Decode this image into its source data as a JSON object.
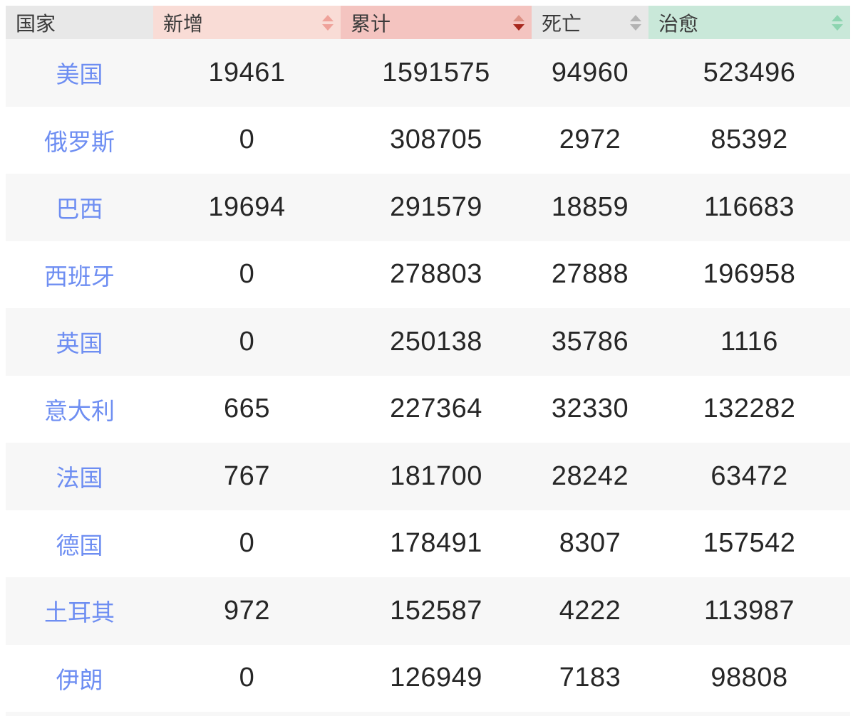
{
  "table": {
    "columns": [
      {
        "key": "country",
        "label": "国家",
        "sortable": false,
        "bg": "#e8e8e8"
      },
      {
        "key": "new",
        "label": "新增",
        "sortable": true,
        "bg": "#f9dcd6",
        "sort": "none",
        "caret_up_color": "#efa29a",
        "caret_down_color": "#efa29a"
      },
      {
        "key": "total",
        "label": "累计",
        "sortable": true,
        "bg": "#f4c4c0",
        "sort": "desc",
        "caret_up_color": "#dd9185",
        "caret_down_color": "#a7281e"
      },
      {
        "key": "deaths",
        "label": "死亡",
        "sortable": true,
        "bg": "#e8e8e8",
        "sort": "none",
        "caret_up_color": "#b3b3b3",
        "caret_down_color": "#b3b3b3"
      },
      {
        "key": "recovered",
        "label": "治愈",
        "sortable": true,
        "bg": "#c9e8d9",
        "sort": "none",
        "caret_up_color": "#8dd4b0",
        "caret_down_color": "#8dd4b0"
      }
    ],
    "rows": [
      {
        "country": "美国",
        "new": "19461",
        "total": "1591575",
        "deaths": "94960",
        "recovered": "523496"
      },
      {
        "country": "俄罗斯",
        "new": "0",
        "total": "308705",
        "deaths": "2972",
        "recovered": "85392"
      },
      {
        "country": "巴西",
        "new": "19694",
        "total": "291579",
        "deaths": "18859",
        "recovered": "116683"
      },
      {
        "country": "西班牙",
        "new": "0",
        "total": "278803",
        "deaths": "27888",
        "recovered": "196958"
      },
      {
        "country": "英国",
        "new": "0",
        "total": "250138",
        "deaths": "35786",
        "recovered": "1116"
      },
      {
        "country": "意大利",
        "new": "665",
        "total": "227364",
        "deaths": "32330",
        "recovered": "132282"
      },
      {
        "country": "法国",
        "new": "767",
        "total": "181700",
        "deaths": "28242",
        "recovered": "63472"
      },
      {
        "country": "德国",
        "new": "0",
        "total": "178491",
        "deaths": "8307",
        "recovered": "157542"
      },
      {
        "country": "土耳其",
        "new": "972",
        "total": "152587",
        "deaths": "4222",
        "recovered": "113987"
      },
      {
        "country": "伊朗",
        "new": "0",
        "total": "126949",
        "deaths": "7183",
        "recovered": "98808"
      }
    ]
  },
  "colors": {
    "link_blue": "#6e8ef2",
    "number_text": "#262626",
    "header_text": "#3a3a3a",
    "row_alt_bg": "#f7f7f7",
    "header_gray_bg": "#e8e8e8",
    "header_new_bg": "#f9dcd6",
    "header_total_bg": "#f4c4c0",
    "header_cure_bg": "#c9e8d9",
    "sort_active_down": "#a7281e"
  }
}
